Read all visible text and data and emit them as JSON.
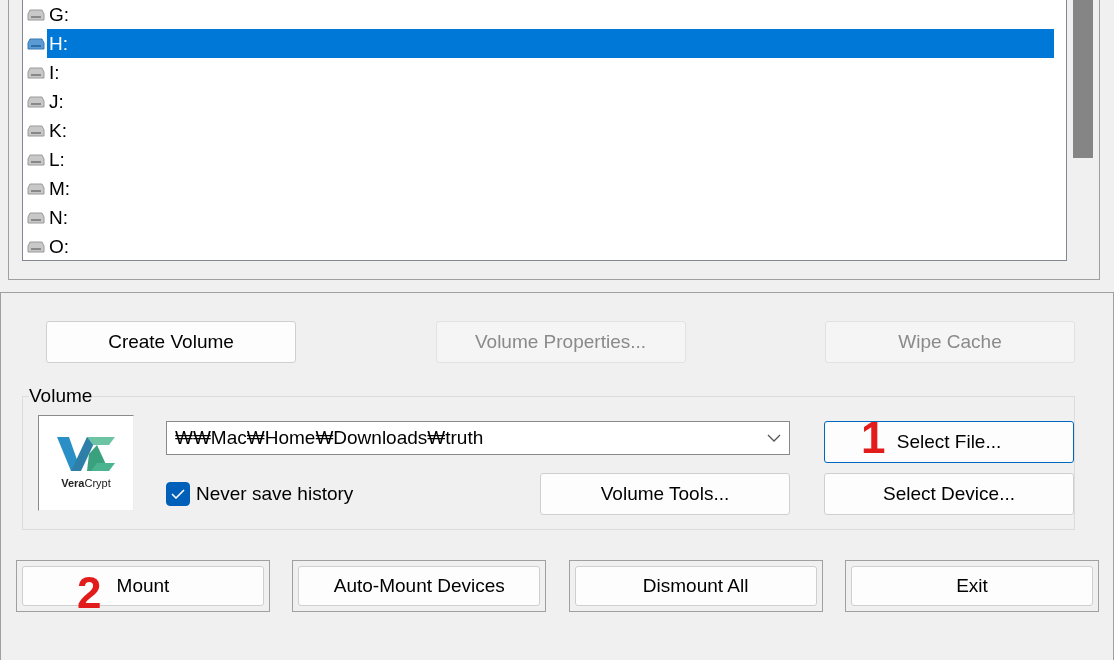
{
  "drives": [
    {
      "label": "G:",
      "selected": false
    },
    {
      "label": "H:",
      "selected": true
    },
    {
      "label": "I:",
      "selected": false
    },
    {
      "label": "J:",
      "selected": false
    },
    {
      "label": "K:",
      "selected": false
    },
    {
      "label": "L:",
      "selected": false
    },
    {
      "label": "M:",
      "selected": false
    },
    {
      "label": "N:",
      "selected": false
    },
    {
      "label": "O:",
      "selected": false
    }
  ],
  "top_buttons": [
    {
      "label": "Create Volume",
      "disabled": false
    },
    {
      "label": "Volume Properties...",
      "disabled": true
    },
    {
      "label": "Wipe Cache",
      "disabled": true
    }
  ],
  "volume": {
    "title": "Volume",
    "logo_text": "**Vera**Crypt",
    "path": "₩₩Mac₩Home₩Downloads₩truth",
    "never_save_history": {
      "label": "Never save history",
      "checked": true
    },
    "buttons": [
      {
        "label": "Select File...",
        "focused": true,
        "annotation": "1"
      },
      {
        "label": "Volume Tools...",
        "focused": false
      },
      {
        "label": "Select Device...",
        "focused": false
      }
    ]
  },
  "bottom_buttons": [
    {
      "label": "Mount",
      "annotation": "2"
    },
    {
      "label": "Auto-Mount Devices"
    },
    {
      "label": "Dismount All"
    },
    {
      "label": "Exit"
    }
  ]
}
